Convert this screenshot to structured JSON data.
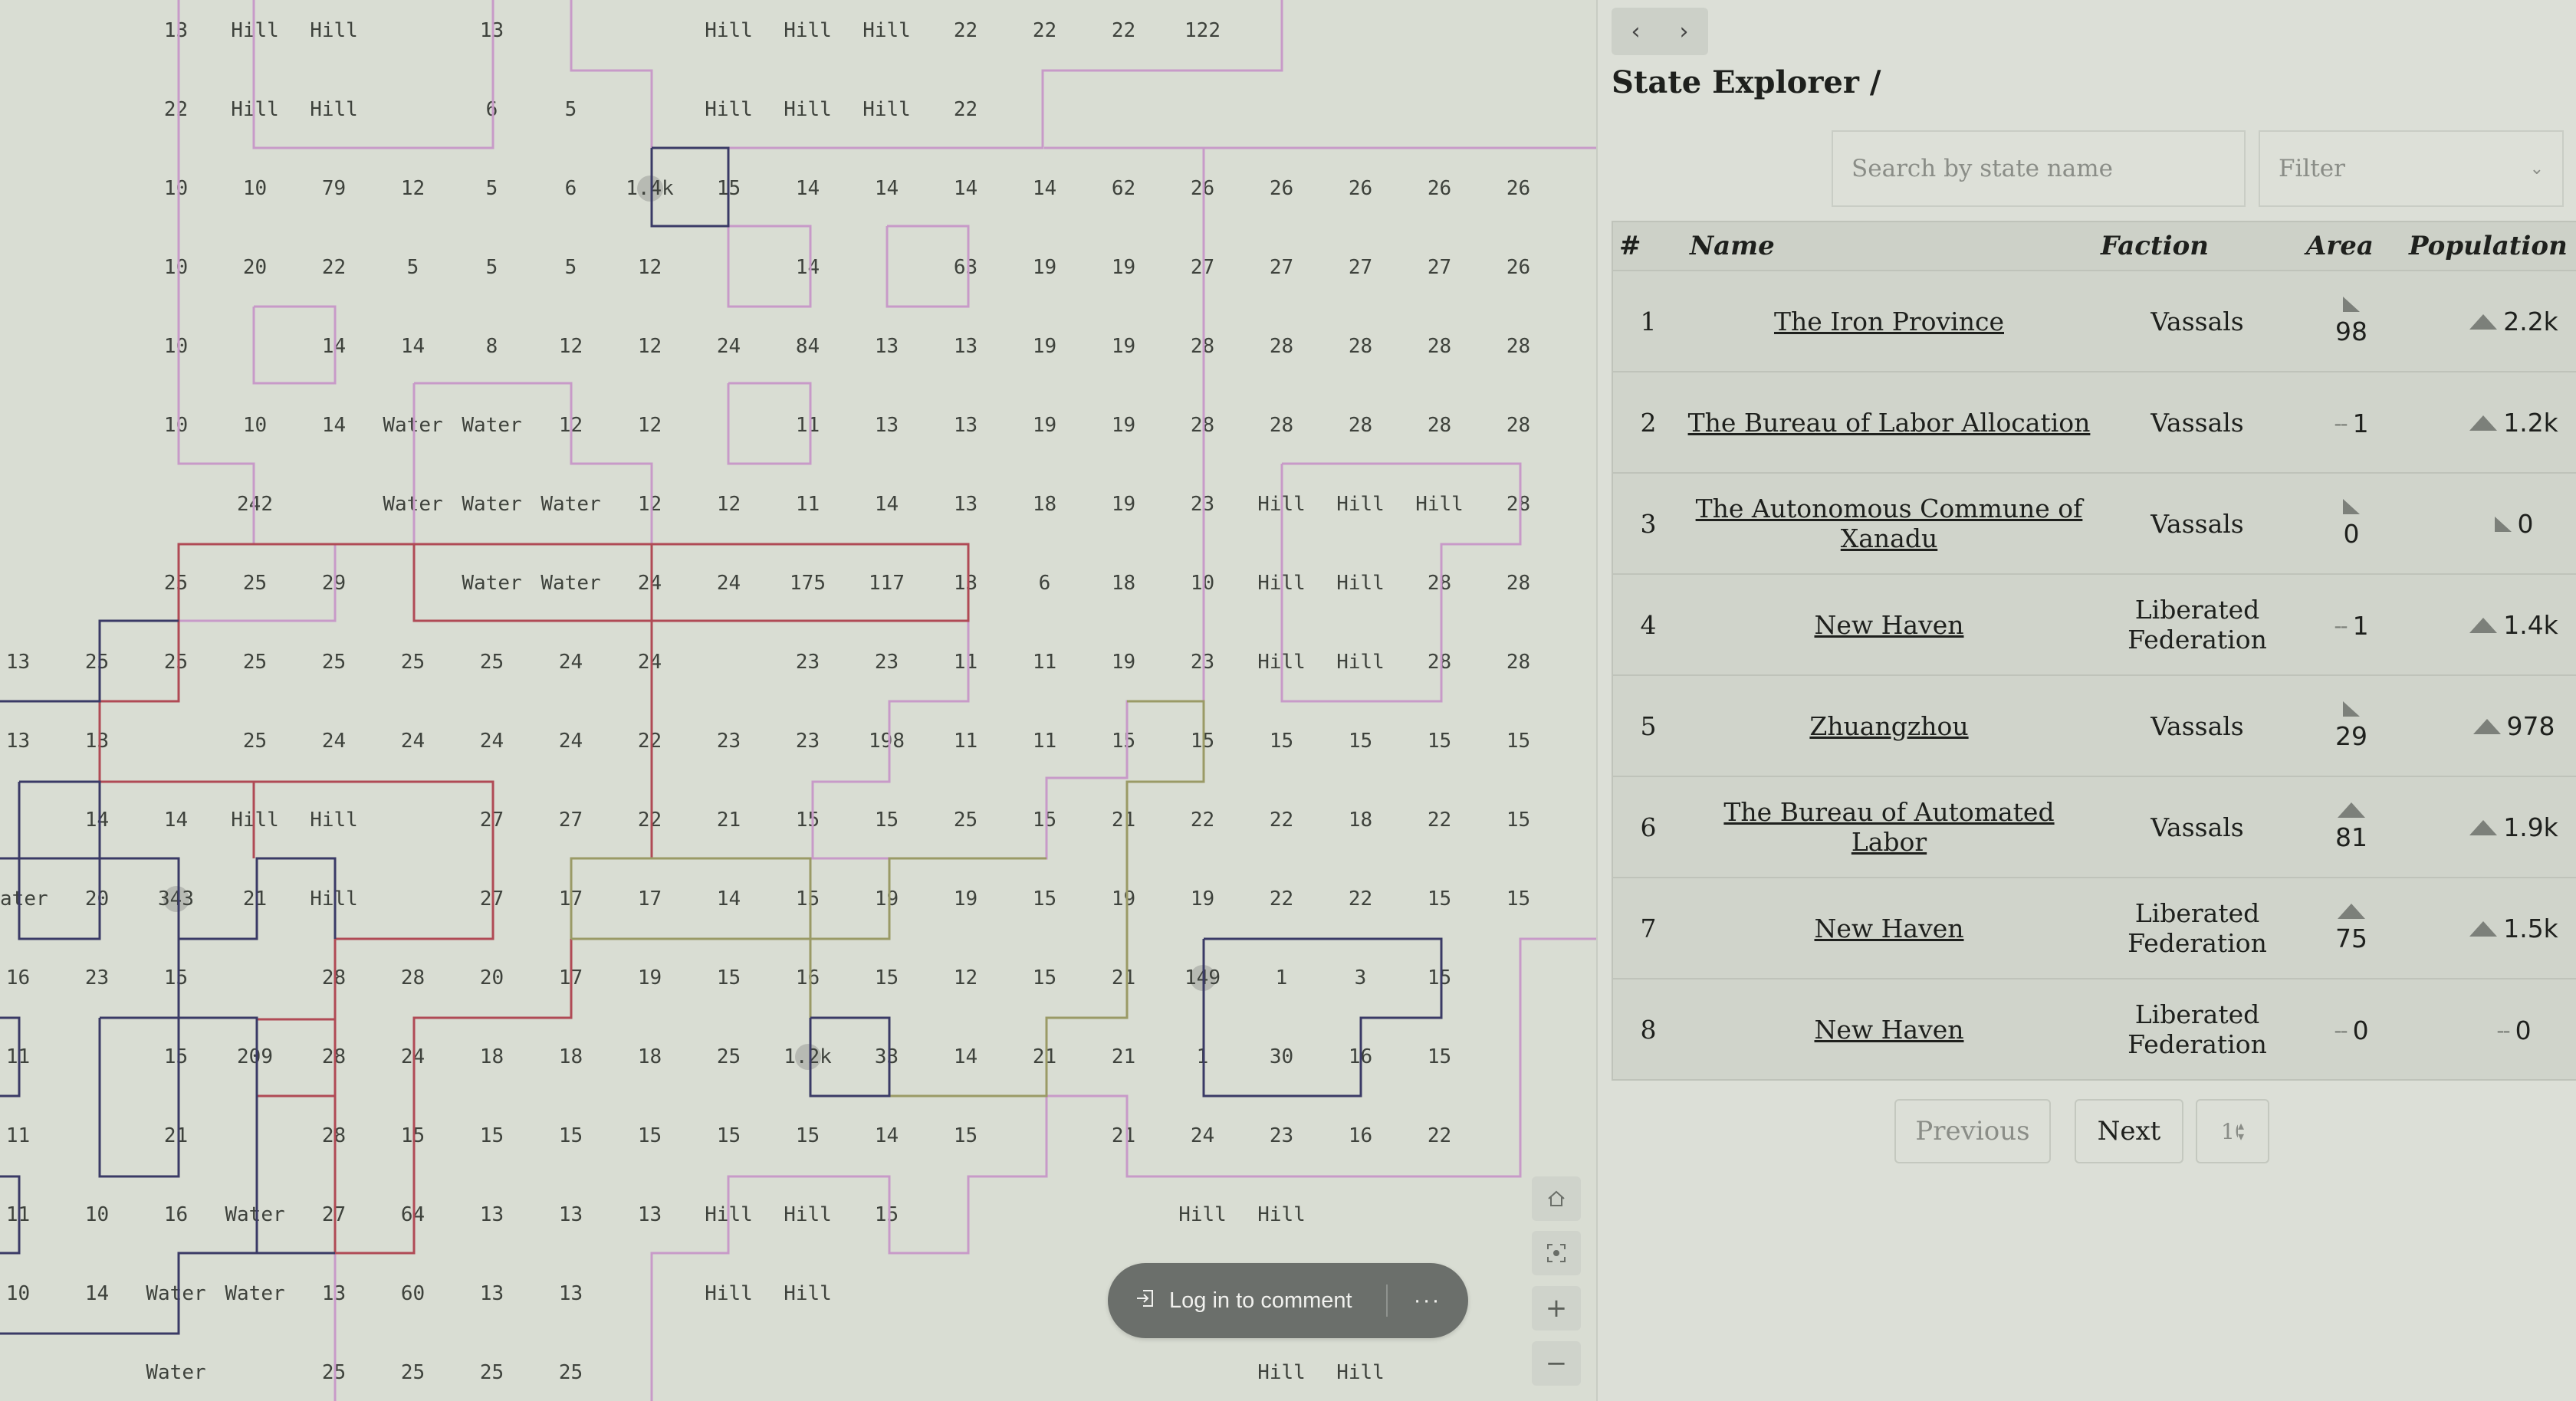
{
  "map": {
    "rows": [
      [
        "",
        "",
        "13",
        "Hill",
        "Hill",
        "",
        "13",
        "",
        "",
        "Hill",
        "Hill",
        "Hill",
        "22",
        "22",
        "22",
        "122",
        "",
        "",
        "",
        "",
        ""
      ],
      [
        "",
        "",
        "22",
        "Hill",
        "Hill",
        "",
        "6",
        "5",
        "",
        "Hill",
        "Hill",
        "Hill",
        "22",
        "",
        "",
        "",
        "",
        "",
        "",
        "",
        ""
      ],
      [
        "",
        "",
        "10",
        "10",
        "79",
        "12",
        "5",
        "6",
        "1.4k",
        "15",
        "14",
        "14",
        "14",
        "14",
        "62",
        "26",
        "26",
        "26",
        "26",
        "26"
      ],
      [
        "",
        "",
        "10",
        "20",
        "22",
        "5",
        "5",
        "5",
        "12",
        "",
        "14",
        "",
        "63",
        "19",
        "19",
        "27",
        "27",
        "27",
        "27",
        "26"
      ],
      [
        "",
        "",
        "10",
        "",
        "14",
        "14",
        "8",
        "12",
        "12",
        "24",
        "84",
        "13",
        "13",
        "19",
        "19",
        "28",
        "28",
        "28",
        "28",
        "28"
      ],
      [
        "",
        "",
        "10",
        "10",
        "14",
        "Water",
        "Water",
        "12",
        "12",
        "",
        "11",
        "13",
        "13",
        "19",
        "19",
        "28",
        "28",
        "28",
        "28",
        "28"
      ],
      [
        "",
        "",
        "",
        "242",
        "",
        "Water",
        "Water",
        "Water",
        "12",
        "12",
        "11",
        "14",
        "13",
        "18",
        "19",
        "23",
        "Hill",
        "Hill",
        "Hill",
        "28"
      ],
      [
        "",
        "",
        "25",
        "25",
        "29",
        "",
        "Water",
        "Water",
        "24",
        "24",
        "175",
        "117",
        "13",
        "6",
        "18",
        "10",
        "Hill",
        "Hill",
        "28",
        "28"
      ],
      [
        "13",
        "25",
        "25",
        "25",
        "25",
        "25",
        "25",
        "24",
        "24",
        "",
        "23",
        "23",
        "11",
        "11",
        "19",
        "23",
        "Hill",
        "Hill",
        "28",
        "28"
      ],
      [
        "13",
        "13",
        "",
        "25",
        "24",
        "24",
        "24",
        "24",
        "22",
        "23",
        "23",
        "198",
        "11",
        "11",
        "15",
        "15",
        "15",
        "15",
        "15",
        "15"
      ],
      [
        "",
        "14",
        "14",
        "Hill",
        "Hill",
        "",
        "27",
        "27",
        "22",
        "21",
        "15",
        "15",
        "25",
        "15",
        "21",
        "22",
        "22",
        "18",
        "22",
        "15"
      ],
      [
        "Water",
        "20",
        "343",
        "21",
        "Hill",
        "",
        "27",
        "17",
        "17",
        "14",
        "15",
        "19",
        "19",
        "15",
        "19",
        "19",
        "22",
        "22",
        "15",
        "15"
      ],
      [
        "16",
        "23",
        "15",
        "",
        "28",
        "28",
        "20",
        "17",
        "19",
        "15",
        "16",
        "15",
        "12",
        "15",
        "21",
        "149",
        "1",
        "3",
        "15",
        ""
      ],
      [
        "11",
        "",
        "15",
        "209",
        "28",
        "24",
        "18",
        "18",
        "18",
        "25",
        "1.2k",
        "33",
        "14",
        "21",
        "21",
        "1",
        "30",
        "16",
        "15",
        ""
      ],
      [
        "11",
        "",
        "21",
        "",
        "28",
        "15",
        "15",
        "15",
        "15",
        "15",
        "15",
        "14",
        "15",
        "",
        "21",
        "24",
        "23",
        "16",
        "22",
        ""
      ],
      [
        "11",
        "10",
        "16",
        "Water",
        "27",
        "64",
        "13",
        "13",
        "13",
        "Hill",
        "Hill",
        "15",
        "",
        "",
        "",
        "Hill",
        "Hill",
        "",
        "",
        ""
      ],
      [
        "10",
        "14",
        "Water",
        "Water",
        "13",
        "60",
        "13",
        "13",
        "",
        "Hill",
        "Hill",
        "",
        "",
        "",
        "",
        "",
        "",
        "",
        "",
        ""
      ],
      [
        "",
        "",
        "Water",
        "",
        "25",
        "25",
        "25",
        "25",
        "",
        "",
        "",
        "",
        "",
        "",
        "",
        "",
        "Hill",
        "Hill",
        "",
        ""
      ]
    ],
    "capitals": [
      "1.4k",
      "1.2k",
      "343",
      "149"
    ],
    "controls": {
      "home_icon": "home-icon",
      "focus_icon": "focus-icon",
      "zoom_in": "+",
      "zoom_out": "−"
    },
    "comment": {
      "label": "Log in to comment",
      "more": "···"
    }
  },
  "panel": {
    "title": "State Explorer /",
    "search_placeholder": "Search by state name",
    "filter_label": "Filter",
    "columns": {
      "num": "#",
      "name": "Name",
      "faction": "Faction",
      "area": "Area",
      "population": "Population"
    },
    "rows": [
      {
        "num": "1",
        "name": "The Iron Province",
        "faction": "Vassals",
        "area": "98",
        "area_trend": "corner",
        "population": "2.2k",
        "pop_trend": "up"
      },
      {
        "num": "2",
        "name": "The Bureau of Labor Allocation",
        "faction": "Vassals",
        "area": "1",
        "area_trend": "flat",
        "population": "1.2k",
        "pop_trend": "up"
      },
      {
        "num": "3",
        "name": "The Autonomous Commune of Xanadu",
        "faction": "Vassals",
        "area": "0",
        "area_trend": "corner",
        "population": "0",
        "pop_trend": "corner"
      },
      {
        "num": "4",
        "name": "New Haven",
        "faction": "Liberated Federation",
        "area": "1",
        "area_trend": "flat",
        "population": "1.4k",
        "pop_trend": "up"
      },
      {
        "num": "5",
        "name": "Zhuangzhou",
        "faction": "Vassals",
        "area": "29",
        "area_trend": "corner",
        "population": "978",
        "pop_trend": "up"
      },
      {
        "num": "6",
        "name": "The Bureau of Automated Labor",
        "faction": "Vassals",
        "area": "81",
        "area_trend": "up",
        "population": "1.9k",
        "pop_trend": "up"
      },
      {
        "num": "7",
        "name": "New Haven",
        "faction": "Liberated Federation",
        "area": "75",
        "area_trend": "up",
        "population": "1.5k",
        "pop_trend": "up"
      },
      {
        "num": "8",
        "name": "New Haven",
        "faction": "Liberated Federation",
        "area": "0",
        "area_trend": "flat",
        "population": "0",
        "pop_trend": "flat"
      }
    ],
    "pager": {
      "previous": "Previous",
      "next": "Next",
      "page_size": "10"
    },
    "colors": {
      "pink_border": "#c89ac8",
      "red_border": "#b04a55",
      "olive_border": "#9a9a66",
      "navy_border": "#3a3a66"
    }
  }
}
